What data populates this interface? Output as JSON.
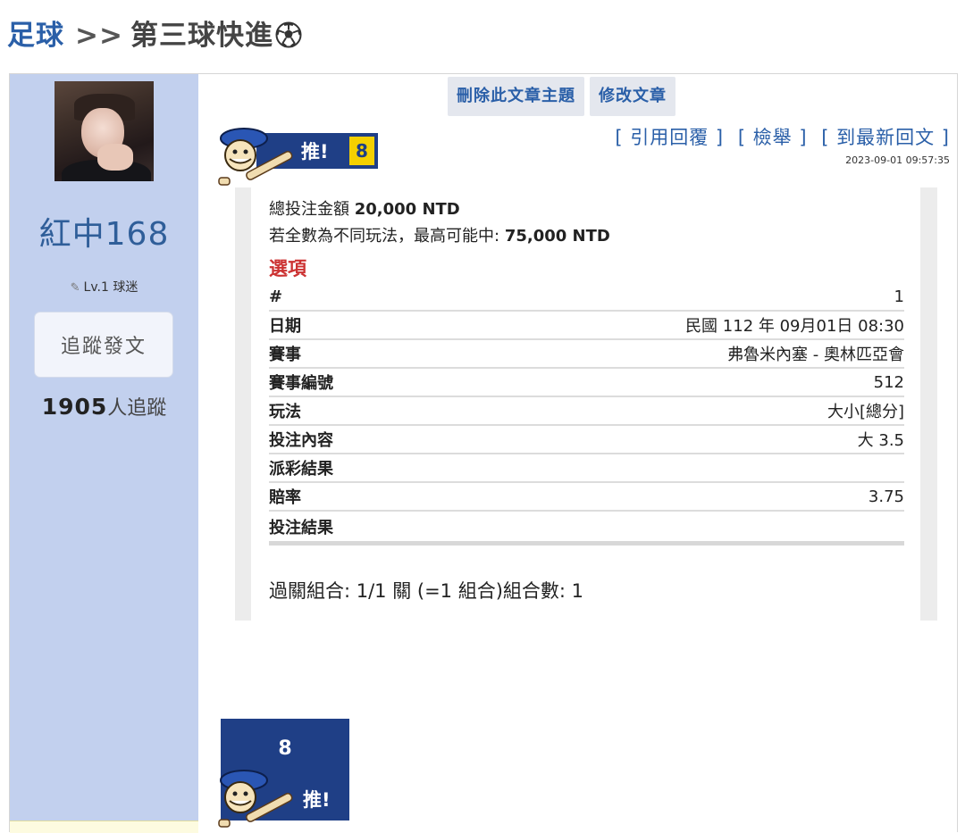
{
  "breadcrumb": {
    "category": "足球",
    "separator": ">>",
    "topic": "第三球快進"
  },
  "user": {
    "name": "紅中168",
    "level": "Lv.1 球迷",
    "follow_label": "追蹤發文",
    "follower_count": "1905",
    "follower_suffix": "人追蹤"
  },
  "admin": {
    "delete_label": "刪除此文章主題",
    "edit_label": "修改文章"
  },
  "actions": {
    "quote_reply": "[ 引用回覆 ]",
    "report": "[ 檢舉 ]",
    "latest_reply": "[ 到最新回文 ]"
  },
  "post": {
    "timestamp": "2023-09-01 09:57:35",
    "push_label": "推!",
    "push_count": "8"
  },
  "bet": {
    "total_label": "總投注金額",
    "total_amount": "20,000 NTD",
    "max_win_label": "若全數為不同玩法，最高可能中:",
    "max_win_amount": "75,000 NTD",
    "options_title": "選項",
    "rows": [
      {
        "key": "#",
        "value": "1"
      },
      {
        "key": "日期",
        "value": "民國 112 年 09月01日 08:30"
      },
      {
        "key": "賽事",
        "value": "弗魯米內塞 - 奧林匹亞會"
      },
      {
        "key": "賽事編號",
        "value": "512"
      },
      {
        "key": "玩法",
        "value": "大小[總分]"
      },
      {
        "key": "投注內容",
        "value": "大 3.5"
      },
      {
        "key": "派彩結果",
        "value": ""
      },
      {
        "key": "賠率",
        "value": "3.75"
      },
      {
        "key": "投注結果",
        "value": ""
      }
    ],
    "parlay": "過關組合: 1/1 關 (=1 組合)組合數: 1"
  },
  "colors": {
    "sidebar_bg": "#c2d0ee",
    "link_blue": "#2a5fa8",
    "push_blue": "#1f3f86",
    "push_count_yellow": "#f5d000",
    "options_red": "#cc3333"
  },
  "icons": {
    "soccer": "soccer-ball-icon",
    "mascot": "baseball-mascot-icon",
    "pencil": "pencil-icon"
  }
}
